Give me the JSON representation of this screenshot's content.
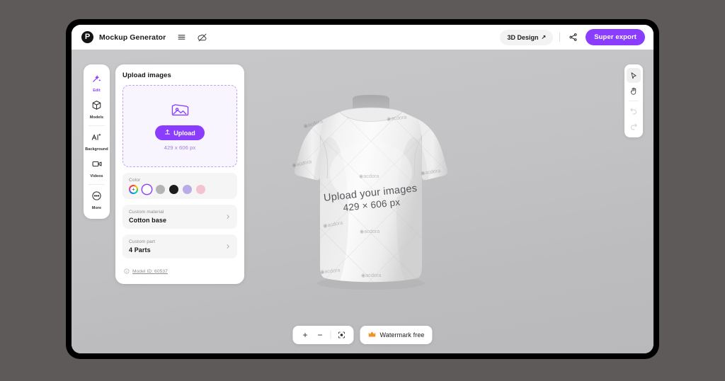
{
  "header": {
    "logo_icon": "pacdora-logo-icon",
    "title": "Mockup Generator",
    "menu_icon": "hamburger-menu-icon",
    "offline_icon": "cloud-off-icon",
    "design_mode_label": "3D Design",
    "design_mode_arrow": "↗",
    "share_icon": "share-icon",
    "super_export_label": "Super export"
  },
  "sidebar": {
    "items": [
      {
        "label": "Edit",
        "icon": "magic-wand-icon",
        "active": true
      },
      {
        "label": "Models",
        "icon": "cube-icon",
        "active": false
      },
      {
        "label": "Background",
        "icon": "ai-sparkle-icon",
        "active": false
      },
      {
        "label": "Videos",
        "icon": "video-camera-icon",
        "active": false
      },
      {
        "label": "More",
        "icon": "more-dots-icon",
        "active": false
      }
    ]
  },
  "panel": {
    "title": "Upload images",
    "dropzone": {
      "image_icon": "image-placeholder-icon",
      "upload_icon": "upload-arrow-icon",
      "upload_label": "Upload",
      "dimensions": "429 x 606 px"
    },
    "color": {
      "label": "Color",
      "swatches": [
        {
          "name": "color-picker",
          "hex": "rainbow",
          "selected": false
        },
        {
          "name": "white",
          "hex": "#ffffff",
          "selected": true
        },
        {
          "name": "gray",
          "hex": "#b4b4b4",
          "selected": false
        },
        {
          "name": "black",
          "hex": "#1c1c1c",
          "selected": false
        },
        {
          "name": "lavender",
          "hex": "#b9aae8",
          "selected": false
        },
        {
          "name": "pink",
          "hex": "#f4c2d0",
          "selected": false
        }
      ]
    },
    "material": {
      "label": "Custom material",
      "value": "Cotton base",
      "chevron_icon": "chevron-right-icon"
    },
    "part": {
      "label": "Custom part",
      "value": "4 Parts",
      "chevron_icon": "chevron-right-icon"
    },
    "model_id": {
      "info_icon": "info-circle-icon",
      "label": "Model ID: 60537"
    }
  },
  "right_tools": [
    {
      "name": "select-tool",
      "icon": "cursor-arrow-icon",
      "active": true,
      "disabled": false
    },
    {
      "name": "pan-tool",
      "icon": "hand-icon",
      "active": false,
      "disabled": false
    },
    {
      "name": "undo-tool",
      "icon": "undo-arrow-icon",
      "active": false,
      "disabled": true
    },
    {
      "name": "redo-tool",
      "icon": "redo-arrow-icon",
      "active": false,
      "disabled": true
    }
  ],
  "bottom_bar": {
    "zoom_in": "+",
    "zoom_out": "−",
    "fit_icon": "focus-center-icon",
    "watermark_icon": "crown-icon",
    "watermark_label": "Watermark free"
  },
  "canvas": {
    "overlay_line1": "Upload your images",
    "overlay_line2": "429 × 606 px",
    "watermark_text": "acdora",
    "model_name": "t-shirt-mockup"
  },
  "colors": {
    "accent": "#8b3dff",
    "page_background": "#5f5a5a",
    "canvas": "#c3c3c5",
    "frame": "#000000"
  }
}
